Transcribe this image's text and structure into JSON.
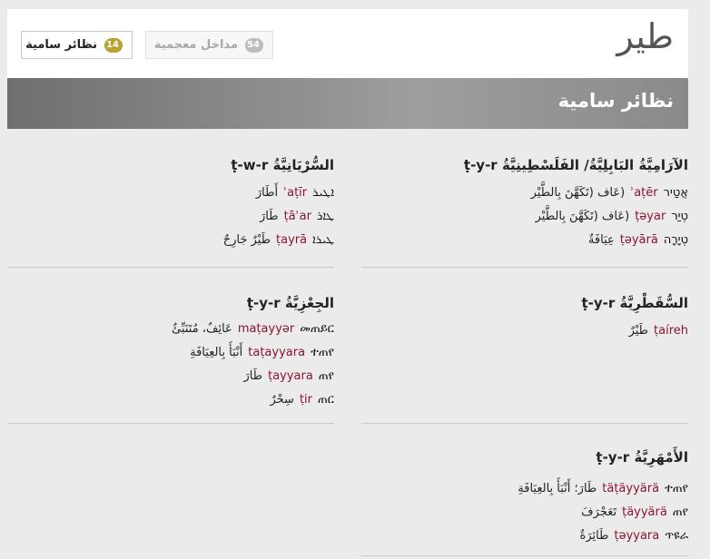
{
  "header": {
    "root": "طير",
    "tabs": [
      {
        "label": "نظائر سامية",
        "count": "14"
      },
      {
        "label": "مداخل معجمية",
        "count": "54"
      }
    ]
  },
  "banner": {
    "title": "نظائر سامية"
  },
  "sections": {
    "aramaic": {
      "title": "الآرَامِيَّةُ البَابِلِيَّةُ/ الفَلَسْطِينِيَّةُ",
      "root": "ṭ-y-r",
      "entries": [
        {
          "native": "אֲטַיר",
          "translit": "ʾaṭēr",
          "gloss": "(عَاف (تَكَهَّنَ بِالطَّيْر"
        },
        {
          "native": "טְיַר",
          "translit": "ṭəyar",
          "gloss": "(عَاف (تَكَهَّنَ بِالطَّيْر"
        },
        {
          "native": "טְיָרָה",
          "translit": "ṭəyārā",
          "gloss": "عِيَافَةٌ"
        }
      ]
    },
    "syriac": {
      "title": "السُّرْيَانِيَّةُ",
      "root": "ṭ-w-r",
      "entries": [
        {
          "native": "ܐܛܝܪ",
          "translit": "ʾaṭīr",
          "gloss": "أَطَارَ"
        },
        {
          "native": "ܛܐܪ",
          "translit": "ṭāʾar",
          "gloss": "طَارَ"
        },
        {
          "native": "ܛܝܪܐ",
          "translit": "ṭayrā",
          "gloss": "طَيْرٌ جَارِحٌ"
        }
      ]
    },
    "soqotri": {
      "title": "السُّقَطْرِيَّةُ",
      "root": "ṭ-y-r",
      "entries": [
        {
          "native": "",
          "translit": "ṭaíreh",
          "gloss": "طَيْرٌ"
        }
      ]
    },
    "geez": {
      "title": "الجِعْزِيَّةُ",
      "root": "ṭ-y-r",
      "entries": [
        {
          "native": "መጠይር",
          "translit": "maṭayyər",
          "gloss": "عَائِفٌ، مُتَنَبِّئٌ"
        },
        {
          "native": "ተጠየ",
          "translit": "taṭayyara",
          "gloss": "أَنْبَأَ بِالعِيَافَةِ"
        },
        {
          "native": "ጠየ",
          "translit": "ṭayyara",
          "gloss": "طَارَ"
        },
        {
          "native": "ጠር",
          "translit": "ṭir",
          "gloss": "سِحْرٌ"
        }
      ]
    },
    "amharic": {
      "title": "الأَمْهَرِيَّةُ",
      "root": "ṭ-y-r",
      "entries": [
        {
          "native": "ተጠየ",
          "translit": "täṭäyyärä",
          "gloss": "طَارَ؛ أَنْبَأَ بِالعِيَافَةِ"
        },
        {
          "native": "ጠየ",
          "translit": "ṭäyyärä",
          "gloss": "تَعَجْرَفَ"
        },
        {
          "native": "ጥዩራ",
          "translit": "ṭəyyara",
          "gloss": "طَائِرَةٌ"
        }
      ]
    }
  }
}
